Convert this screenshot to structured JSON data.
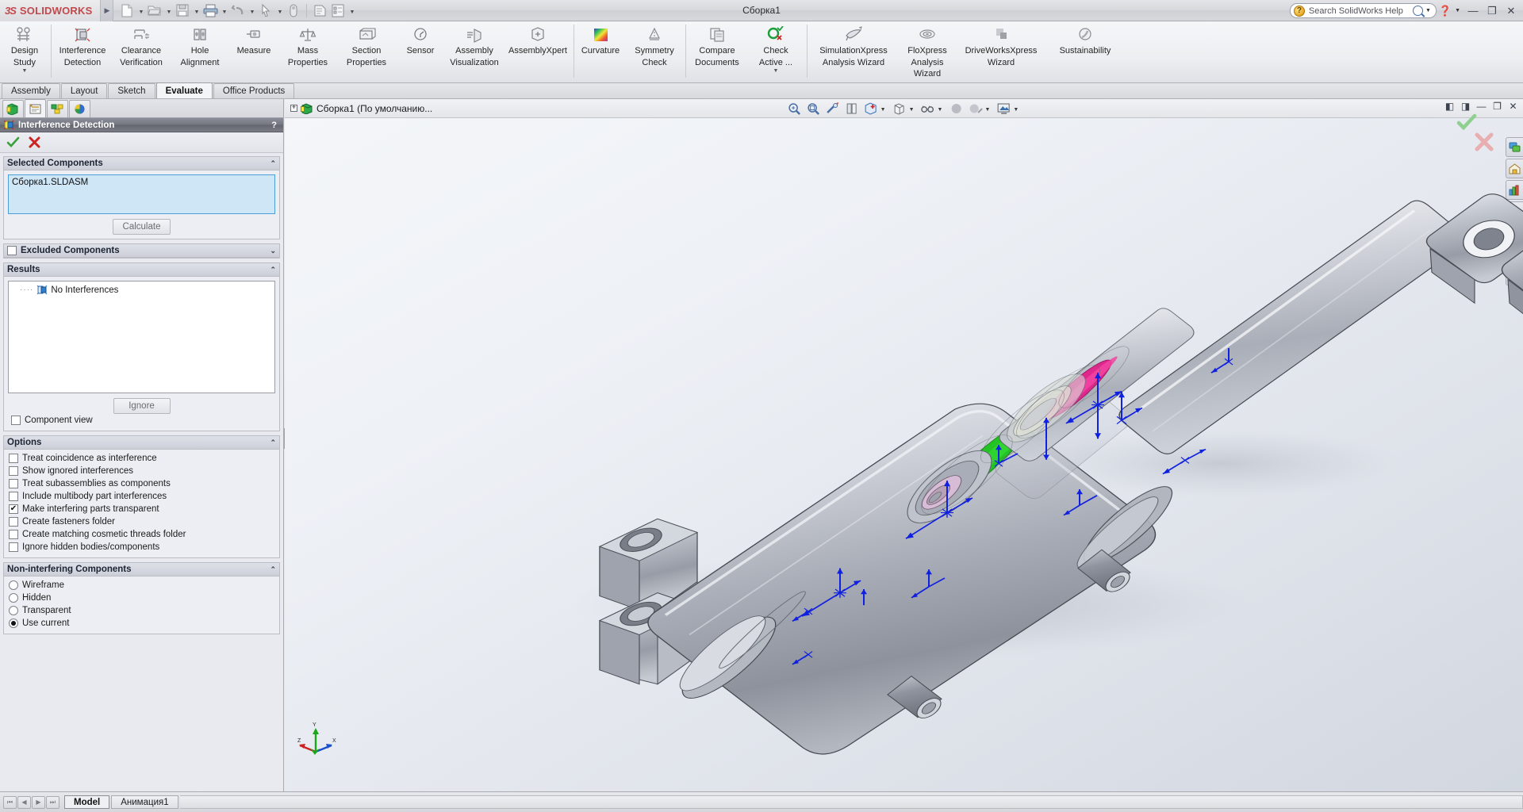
{
  "titlebar": {
    "logo_mark": "3S",
    "logo_word": "SOLIDWORKS",
    "document_title": "Сборка1",
    "quick_access": [
      {
        "name": "new-document",
        "label": "New"
      },
      {
        "name": "open-document",
        "label": "Open"
      },
      {
        "name": "save-document",
        "label": "Save"
      },
      {
        "name": "print-document",
        "label": "Print"
      },
      {
        "name": "undo",
        "label": "Undo"
      },
      {
        "name": "select",
        "label": "Select"
      },
      {
        "name": "rebuild",
        "label": "Rebuild"
      },
      {
        "name": "options",
        "label": "Options"
      },
      {
        "name": "file-properties",
        "label": "File Properties"
      }
    ],
    "search_placeholder": "Search SolidWorks Help",
    "help_label": "?",
    "window_minimize": "—",
    "window_restore": "❐",
    "window_close": "✕"
  },
  "ribbon": {
    "items": [
      {
        "label_line1": "Design",
        "label_line2": "Study",
        "icon": "design-study-icon",
        "dropdown": true
      },
      {
        "label_line1": "Interference",
        "label_line2": "Detection",
        "icon": "interference-detection-icon",
        "dropdown": false
      },
      {
        "label_line1": "Clearance",
        "label_line2": "Verification",
        "icon": "clearance-verification-icon",
        "dropdown": false
      },
      {
        "label_line1": "Hole",
        "label_line2": "Alignment",
        "icon": "hole-alignment-icon",
        "dropdown": false
      },
      {
        "label_line1": "Measure",
        "label_line2": "",
        "icon": "measure-icon",
        "dropdown": false
      },
      {
        "label_line1": "Mass",
        "label_line2": "Properties",
        "icon": "mass-properties-icon",
        "dropdown": false
      },
      {
        "label_line1": "Section",
        "label_line2": "Properties",
        "icon": "section-properties-icon",
        "dropdown": false
      },
      {
        "label_line1": "Sensor",
        "label_line2": "",
        "icon": "sensor-icon",
        "dropdown": false
      },
      {
        "label_line1": "Assembly",
        "label_line2": "Visualization",
        "icon": "assembly-visualization-icon",
        "dropdown": false
      },
      {
        "label_line1": "AssemblyXpert",
        "label_line2": "",
        "icon": "assemblyxpert-icon",
        "dropdown": false
      },
      {
        "label_line1": "Curvature",
        "label_line2": "",
        "icon": "curvature-icon",
        "dropdown": false
      },
      {
        "label_line1": "Symmetry",
        "label_line2": "Check",
        "icon": "symmetry-check-icon",
        "dropdown": false
      },
      {
        "label_line1": "Compare",
        "label_line2": "Documents",
        "icon": "compare-documents-icon",
        "dropdown": false
      },
      {
        "label_line1": "Check",
        "label_line2": "Active ...",
        "icon": "check-active-icon",
        "dropdown": true
      },
      {
        "label_line1": "SimulationXpress",
        "label_line2": "Analysis Wizard",
        "icon": "simulationxpress-icon",
        "dropdown": false
      },
      {
        "label_line1": "FloXpress",
        "label_line2": "Analysis",
        "label_line3": "Wizard",
        "icon": "floxpress-icon",
        "dropdown": false
      },
      {
        "label_line1": "DriveWorksXpress",
        "label_line2": "Wizard",
        "icon": "driveworksxpress-icon",
        "dropdown": false
      },
      {
        "label_line1": "Sustainability",
        "label_line2": "",
        "icon": "sustainability-icon",
        "dropdown": false
      }
    ]
  },
  "command_tabs": [
    {
      "label": "Assembly",
      "active": false
    },
    {
      "label": "Layout",
      "active": false
    },
    {
      "label": "Sketch",
      "active": false
    },
    {
      "label": "Evaluate",
      "active": true
    },
    {
      "label": "Office Products",
      "active": false
    }
  ],
  "property_manager": {
    "tabs": [
      {
        "name": "feature-manager-tab",
        "icon": "feature-tree-icon",
        "active": false
      },
      {
        "name": "property-manager-tab",
        "icon": "property-manager-icon",
        "active": true
      },
      {
        "name": "configuration-manager-tab",
        "icon": "configuration-manager-icon",
        "active": false
      },
      {
        "name": "display-manager-tab",
        "icon": "display-manager-icon",
        "active": false
      }
    ],
    "title": "Interference Detection",
    "help_glyph": "?",
    "ok_label": "OK",
    "cancel_label": "Cancel",
    "selected_components": {
      "header": "Selected Components",
      "items": [
        "Сборка1.SLDASM"
      ],
      "calculate_label": "Calculate"
    },
    "excluded_components": {
      "header": "Excluded Components",
      "checked": false
    },
    "results": {
      "header": "Results",
      "node_label": "No Interferences",
      "ignore_label": "Ignore",
      "component_view_label": "Component view",
      "component_view_checked": false
    },
    "options": {
      "header": "Options",
      "items": [
        {
          "label": "Treat coincidence as interference",
          "checked": false
        },
        {
          "label": "Show ignored interferences",
          "checked": false
        },
        {
          "label": "Treat subassemblies as components",
          "checked": false
        },
        {
          "label": "Include multibody part interferences",
          "checked": false
        },
        {
          "label": "Make interfering parts transparent",
          "checked": true
        },
        {
          "label": "Create fasteners folder",
          "checked": false
        },
        {
          "label": "Create matching cosmetic threads folder",
          "checked": false
        },
        {
          "label": "Ignore hidden bodies/components",
          "checked": false
        }
      ]
    },
    "non_interfering": {
      "header": "Non-interfering Components",
      "items": [
        {
          "label": "Wireframe",
          "selected": false
        },
        {
          "label": "Hidden",
          "selected": false
        },
        {
          "label": "Transparent",
          "selected": false
        },
        {
          "label": "Use current",
          "selected": true
        }
      ]
    }
  },
  "graphics": {
    "tree_root_label": "Сборка1  (По умолчанию...",
    "view_toolbar": [
      {
        "name": "zoom-to-fit-icon",
        "dropdown": false
      },
      {
        "name": "zoom-to-area-icon",
        "dropdown": false
      },
      {
        "name": "previous-view-icon",
        "dropdown": false
      },
      {
        "name": "section-view-icon",
        "dropdown": false
      },
      {
        "name": "view-orientation-icon",
        "dropdown": true
      },
      {
        "name": "display-style-icon",
        "dropdown": true
      },
      {
        "name": "hide-show-items-icon",
        "dropdown": true
      },
      {
        "name": "edit-appearance-icon",
        "dropdown": false
      },
      {
        "name": "apply-scene-icon",
        "dropdown": true
      },
      {
        "name": "view-settings-icon",
        "dropdown": true
      }
    ],
    "window_buttons": [
      {
        "name": "restore-left-icon",
        "glyph": "◧"
      },
      {
        "name": "restore-right-icon",
        "glyph": "◨"
      },
      {
        "name": "minimize-window-icon",
        "glyph": "—"
      },
      {
        "name": "restore-window-icon",
        "glyph": "❐"
      },
      {
        "name": "close-window-icon",
        "glyph": "✕"
      }
    ],
    "confirmation_corner": {
      "ok": "✔",
      "cancel": "✕"
    },
    "task_pane": [
      {
        "name": "solidworks-resources-icon"
      },
      {
        "name": "design-library-icon"
      },
      {
        "name": "file-explorer-icon"
      },
      {
        "name": "search-tab-icon"
      },
      {
        "name": "view-palette-icon"
      },
      {
        "name": "appearances-scenes-icon"
      },
      {
        "name": "custom-properties-icon"
      }
    ],
    "triad_labels": {
      "x": "X",
      "y": "Y",
      "z": "Z"
    }
  },
  "statusbar": {
    "nav_buttons": [
      "⏮",
      "◀",
      "▶",
      "⏭"
    ],
    "sheet_tabs": [
      {
        "label": "Model",
        "active": true
      },
      {
        "label": "Анимация1",
        "active": false
      }
    ]
  },
  "colors": {
    "brand_red": "#c2484c",
    "selection_blue": "#cfe6f7",
    "accent_green": "#2eb82e",
    "accent_magenta": "#e0218a",
    "pm_header": "#73757f"
  }
}
